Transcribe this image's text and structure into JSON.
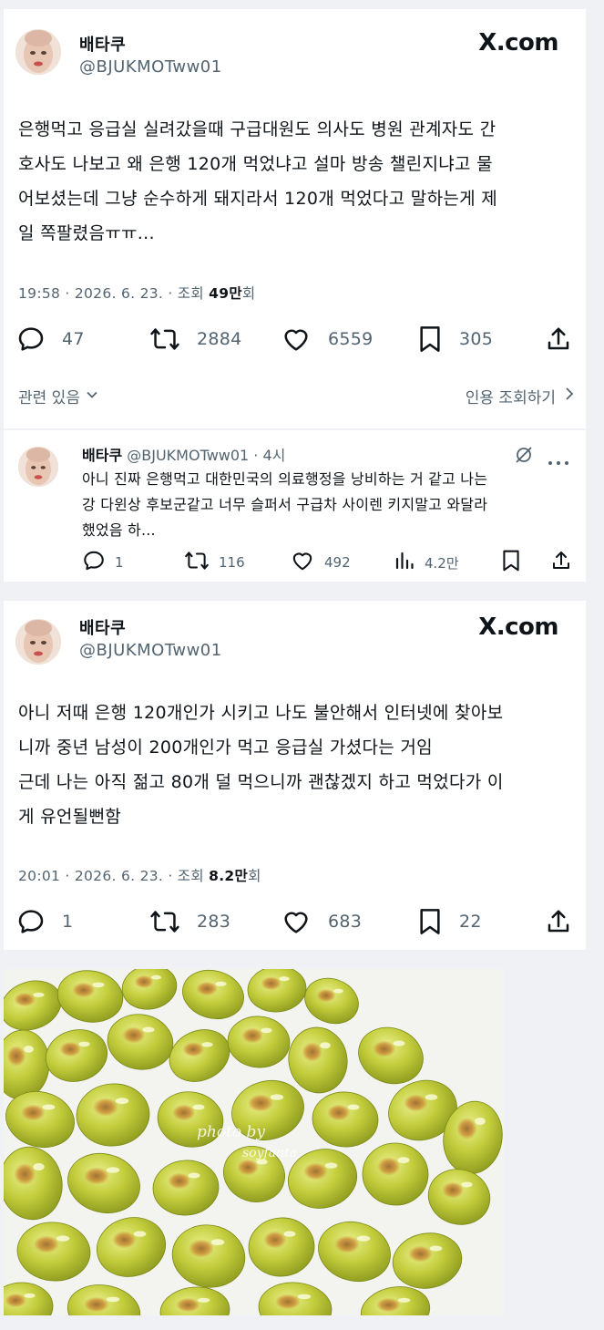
{
  "tweet1": {
    "name": "배타쿠",
    "handle": "@BJUKMOTww01",
    "brand": "X.com",
    "text": "은행먹고 응급실 실려갔을때 구급대원도 의사도 병원 관계자도 간\n호사도 나보고 왜 은행 120개 먹었냐고 설마 방송 챌린지냐고 물\n어보셨는데 그냥 순수하게 돼지라서 120개 먹었다고 말하는게 제\n일 쪽팔렸음ㅠㅠ...",
    "time": "19:58 · 2026. 6. 23. · 조회 ",
    "views": "49만",
    "views_suffix": "회",
    "replies": "47",
    "retweets": "2884",
    "likes": "6559",
    "bookmarks": "305",
    "related": "관련 있음",
    "quote_views": "인용 조회하기"
  },
  "reply": {
    "name": "배타쿠",
    "handle": "@BJUKMOTww01 · 4시",
    "text": "아니 진짜 은행먹고 대한민국의 의료행정을 낭비하는 거 같고 나는\n강 다윈상 후보군같고 너무 슬퍼서 구급차 사이렌 키지말고 와달라\n했었음 하...",
    "replies": "1",
    "retweets": "116",
    "likes": "492",
    "views": "4.2만"
  },
  "tweet2": {
    "name": "배타쿠",
    "handle": "@BJUKMOTww01",
    "brand": "X.com",
    "text": "아니 저때 은행 120개인가 시키고 나도 불안해서 인터넷에 찾아보\n니까 중년 남성이 200개인가 먹고 응급실 가셨다는 거임\n근데 나는 아직 젊고 80개 덜 먹으니까 괜찮겠지 하고 먹었다가 이\n게 유언될뻔함",
    "time": "20:01 · 2026. 6. 23. · 조회 ",
    "views": "8.2만",
    "views_suffix": "회",
    "replies": "1",
    "retweets": "283",
    "likes": "683",
    "bookmarks": "22"
  },
  "photo": {
    "watermark_line1": "photo by",
    "watermark_line2": "soyfanta"
  },
  "icons": [
    "reply-icon",
    "retweet-icon",
    "like-icon",
    "bookmark-icon",
    "share-icon",
    "views-icon",
    "grok-icon",
    "more-icon",
    "chevron-down-icon",
    "chevron-right-icon"
  ],
  "colors": {
    "text": "#0f1419",
    "secondary": "#536471",
    "background": "#eff1f4",
    "card": "#ffffff"
  }
}
